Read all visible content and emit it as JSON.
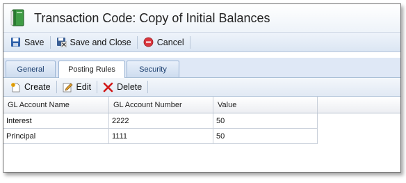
{
  "window": {
    "title": "Transaction Code: Copy of Initial Balances",
    "icon": "green-book-icon"
  },
  "toolbar": {
    "save_label": "Save",
    "save_close_label": "Save and Close",
    "cancel_label": "Cancel"
  },
  "tabs": [
    {
      "label": "General",
      "active": false
    },
    {
      "label": "Posting Rules",
      "active": true
    },
    {
      "label": "Security",
      "active": false
    }
  ],
  "grid_toolbar": {
    "create_label": "Create",
    "edit_label": "Edit",
    "delete_label": "Delete"
  },
  "grid": {
    "columns": [
      "GL Account Name",
      "GL Account Number",
      "Value"
    ],
    "rows": [
      [
        "Interest",
        "2222",
        "50"
      ],
      [
        "Principal",
        "1111",
        "50"
      ]
    ]
  },
  "colors": {
    "accent": "#dfe8f6",
    "delete_red": "#d11a1a",
    "cancel_red": "#d9363e",
    "book_green": "#2e8b3a"
  }
}
